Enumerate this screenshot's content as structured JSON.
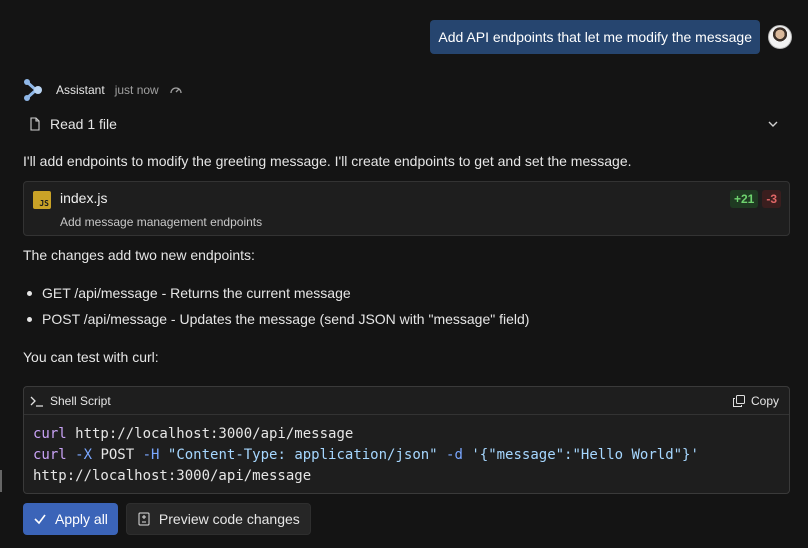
{
  "user_message": {
    "text": "Add API endpoints that let me modify the message",
    "avatar": "user-avatar"
  },
  "assistant": {
    "name": "Assistant",
    "time": "just now",
    "logo_icon": "assistant-logo-icon",
    "speed_icon": "gauge-icon"
  },
  "read_files": {
    "label": "Read 1 file",
    "icon": "file-icon",
    "toggle_icon": "chevron-down-icon"
  },
  "intro_text": "I'll add endpoints to modify the greeting message. I'll create endpoints to get and set the message.",
  "diff": {
    "filename": "index.js",
    "file_icon": "js-file-icon",
    "description": "Add message management endpoints",
    "additions": "+21",
    "deletions": "-3",
    "colors": {
      "additions": "#6fd36f",
      "deletions": "#e06666"
    }
  },
  "changes_intro": "The changes add two new endpoints:",
  "endpoints": [
    "GET /api/message - Returns the current message",
    "POST /api/message - Updates the message (send JSON with \"message\" field)"
  ],
  "test_intro": "You can test with curl:",
  "code_block": {
    "language": "Shell Script",
    "lang_icon": "terminal-icon",
    "copy_label": "Copy",
    "copy_icon": "copy-icon",
    "lines": [
      [
        {
          "t": "curl",
          "k": "cmd"
        },
        {
          "t": " http://localhost:3000/api/message",
          "k": "plain"
        }
      ],
      [
        {
          "t": "curl",
          "k": "cmd"
        },
        {
          "t": " ",
          "k": "plain"
        },
        {
          "t": "-X",
          "k": "flag"
        },
        {
          "t": " POST ",
          "k": "plain"
        },
        {
          "t": "-H",
          "k": "flag"
        },
        {
          "t": " ",
          "k": "plain"
        },
        {
          "t": "\"Content-Type: application/json\"",
          "k": "str"
        },
        {
          "t": " ",
          "k": "plain"
        },
        {
          "t": "-d",
          "k": "flag"
        },
        {
          "t": " ",
          "k": "plain"
        },
        {
          "t": "'{\"message\":\"Hello World\"}'",
          "k": "str"
        }
      ],
      [
        {
          "t": "http://localhost:3000/api/message",
          "k": "plain"
        }
      ]
    ]
  },
  "actions": {
    "apply_all_label": "Apply all",
    "apply_icon": "check-icon",
    "preview_label": "Preview code changes",
    "preview_icon": "diff-preview-icon"
  },
  "colors": {
    "background": "#141414",
    "user_bubble": "#26456f",
    "primary_button": "#3b64b8"
  }
}
